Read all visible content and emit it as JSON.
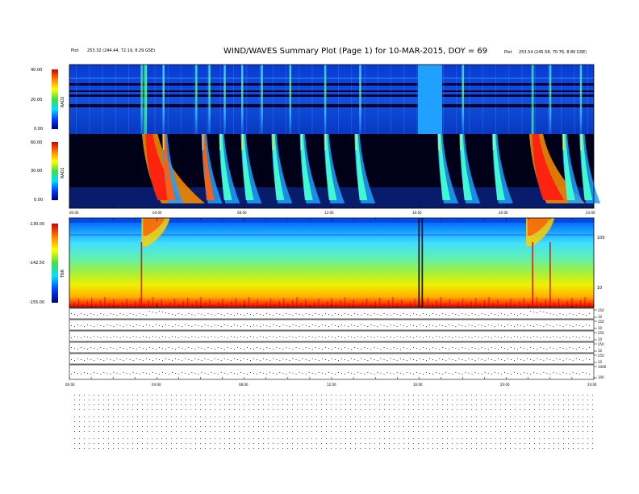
{
  "header": {
    "title": "WIND/WAVES Summary Plot (Page 1) for 10-MAR-2015, DOY = 69",
    "left_line1": "",
    "left_line2": "",
    "left_line3": "Plot",
    "left_coords": "253.32 (244.44, 72.19, 8.29 GSE)",
    "center_top": "",
    "right_top": "",
    "right_line2": "",
    "right_line3": "Plot",
    "right_coords": "253.54 (245.58, 70.76, 8.80 GSE)",
    "rad2_top_left": "",
    "rad2_top_right": ""
  },
  "colors": {
    "background_rad": "#0b3fd0",
    "dark": "#000010",
    "burst_red": "#e01818",
    "tnr_red": "#d80000",
    "tnr_yellow": "#f0f000",
    "tnr_green": "#40e040",
    "tnr_cyan": "#40e0ff"
  },
  "chart_data": [
    {
      "type": "heatmap",
      "name": "RAD2",
      "ylabel": "RAD2",
      "colorbar_ticks": [
        "40.00",
        "20.00",
        "0.00"
      ],
      "ylim": [
        0,
        40
      ],
      "x_ticks": [],
      "data_gap_hours": [
        16.9,
        17.9
      ],
      "burst_hours": [
        3.3,
        3.5,
        4.3,
        5.8,
        6.4,
        7.1,
        7.9,
        8.8,
        10.1,
        11.7,
        13.3,
        16.0,
        18.0,
        22.0,
        23.4
      ]
    },
    {
      "type": "heatmap",
      "name": "RAD1",
      "ylabel": "RAD1",
      "colorbar_ticks": [
        "60.00",
        "30.00",
        "0.00"
      ],
      "ylim": [
        0,
        60
      ],
      "x_ticks": [
        "00:00",
        "04:00",
        "08:00",
        "12:00",
        "16:00",
        "20:00",
        "24:00"
      ],
      "bursts": [
        {
          "hour": 3.5,
          "intensity": 1.0,
          "width_h": 0.9
        },
        {
          "hour": 4.3,
          "intensity": 0.8,
          "width_h": 0.3
        },
        {
          "hour": 6.1,
          "intensity": 0.8,
          "width_h": 0.3
        },
        {
          "hour": 6.9,
          "intensity": 0.7,
          "width_h": 0.3
        },
        {
          "hour": 7.9,
          "intensity": 0.6,
          "width_h": 0.3
        },
        {
          "hour": 9.3,
          "intensity": 0.6,
          "width_h": 0.3
        },
        {
          "hour": 10.6,
          "intensity": 0.6,
          "width_h": 0.3
        },
        {
          "hour": 11.7,
          "intensity": 0.5,
          "width_h": 0.3
        },
        {
          "hour": 13.1,
          "intensity": 0.5,
          "width_h": 0.3
        },
        {
          "hour": 16.9,
          "intensity": 0.4,
          "width_h": 0.3
        },
        {
          "hour": 17.9,
          "intensity": 0.5,
          "width_h": 0.3
        },
        {
          "hour": 19.4,
          "intensity": 0.5,
          "width_h": 0.3
        },
        {
          "hour": 21.2,
          "intensity": 1.0,
          "width_h": 0.8
        },
        {
          "hour": 22.6,
          "intensity": 0.6,
          "width_h": 0.3
        },
        {
          "hour": 23.4,
          "intensity": 0.6,
          "width_h": 0.3
        }
      ]
    },
    {
      "type": "heatmap",
      "name": "TNR",
      "ylabel": "TNR",
      "colorbar_ticks": [
        "-130.00",
        "-142.50",
        "-155.00"
      ],
      "right_ticks": [
        "100",
        "10"
      ],
      "ylim": [
        -155,
        -130
      ],
      "top_right_label": "",
      "marker_hours": [
        16.0,
        16.15
      ],
      "spikes_hours": [
        3.3,
        21.2,
        22.0
      ]
    },
    {
      "type": "line",
      "name": "Sensor panels",
      "x_ticks": [
        "00:00",
        "04:00",
        "08:00",
        "12:00",
        "16:00",
        "20:00",
        "24:00"
      ],
      "rows": [
        {
          "label": "",
          "right_ticks": [
            "250",
            "10"
          ]
        },
        {
          "label": "",
          "right_ticks": [
            "250",
            "10"
          ]
        },
        {
          "label": "",
          "right_ticks": [
            "250",
            "10"
          ]
        },
        {
          "label": "",
          "right_ticks": [
            "250",
            "10"
          ]
        },
        {
          "label": "",
          "right_ticks": [
            "250",
            "10"
          ]
        },
        {
          "label": "",
          "right_ticks": [
            "1000",
            "100"
          ]
        }
      ]
    }
  ],
  "footer": {
    "blocks": [
      {
        "title": "",
        "rows": [
          "",
          "",
          "",
          ""
        ]
      },
      {
        "title": "",
        "rows": [
          "",
          "",
          "",
          ""
        ]
      },
      {
        "title": "",
        "rows": [
          "",
          "",
          ""
        ]
      }
    ]
  }
}
